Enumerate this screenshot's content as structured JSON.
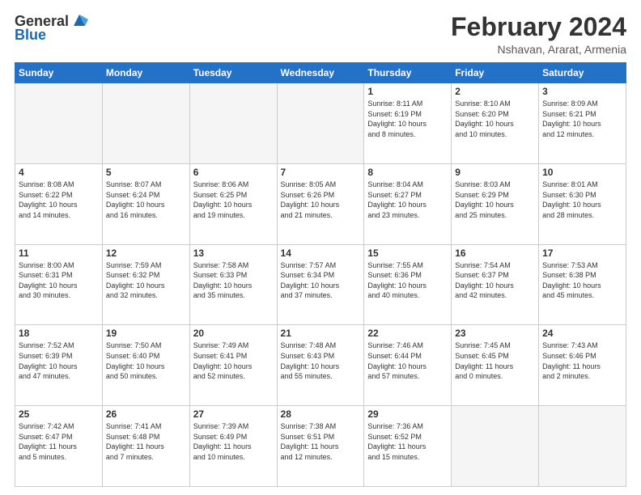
{
  "logo": {
    "general": "General",
    "blue": "Blue"
  },
  "header": {
    "month_year": "February 2024",
    "location": "Nshavan, Ararat, Armenia"
  },
  "weekdays": [
    "Sunday",
    "Monday",
    "Tuesday",
    "Wednesday",
    "Thursday",
    "Friday",
    "Saturday"
  ],
  "weeks": [
    [
      {
        "day": "",
        "info": ""
      },
      {
        "day": "",
        "info": ""
      },
      {
        "day": "",
        "info": ""
      },
      {
        "day": "",
        "info": ""
      },
      {
        "day": "1",
        "info": "Sunrise: 8:11 AM\nSunset: 6:19 PM\nDaylight: 10 hours\nand 8 minutes."
      },
      {
        "day": "2",
        "info": "Sunrise: 8:10 AM\nSunset: 6:20 PM\nDaylight: 10 hours\nand 10 minutes."
      },
      {
        "day": "3",
        "info": "Sunrise: 8:09 AM\nSunset: 6:21 PM\nDaylight: 10 hours\nand 12 minutes."
      }
    ],
    [
      {
        "day": "4",
        "info": "Sunrise: 8:08 AM\nSunset: 6:22 PM\nDaylight: 10 hours\nand 14 minutes."
      },
      {
        "day": "5",
        "info": "Sunrise: 8:07 AM\nSunset: 6:24 PM\nDaylight: 10 hours\nand 16 minutes."
      },
      {
        "day": "6",
        "info": "Sunrise: 8:06 AM\nSunset: 6:25 PM\nDaylight: 10 hours\nand 19 minutes."
      },
      {
        "day": "7",
        "info": "Sunrise: 8:05 AM\nSunset: 6:26 PM\nDaylight: 10 hours\nand 21 minutes."
      },
      {
        "day": "8",
        "info": "Sunrise: 8:04 AM\nSunset: 6:27 PM\nDaylight: 10 hours\nand 23 minutes."
      },
      {
        "day": "9",
        "info": "Sunrise: 8:03 AM\nSunset: 6:29 PM\nDaylight: 10 hours\nand 25 minutes."
      },
      {
        "day": "10",
        "info": "Sunrise: 8:01 AM\nSunset: 6:30 PM\nDaylight: 10 hours\nand 28 minutes."
      }
    ],
    [
      {
        "day": "11",
        "info": "Sunrise: 8:00 AM\nSunset: 6:31 PM\nDaylight: 10 hours\nand 30 minutes."
      },
      {
        "day": "12",
        "info": "Sunrise: 7:59 AM\nSunset: 6:32 PM\nDaylight: 10 hours\nand 32 minutes."
      },
      {
        "day": "13",
        "info": "Sunrise: 7:58 AM\nSunset: 6:33 PM\nDaylight: 10 hours\nand 35 minutes."
      },
      {
        "day": "14",
        "info": "Sunrise: 7:57 AM\nSunset: 6:34 PM\nDaylight: 10 hours\nand 37 minutes."
      },
      {
        "day": "15",
        "info": "Sunrise: 7:55 AM\nSunset: 6:36 PM\nDaylight: 10 hours\nand 40 minutes."
      },
      {
        "day": "16",
        "info": "Sunrise: 7:54 AM\nSunset: 6:37 PM\nDaylight: 10 hours\nand 42 minutes."
      },
      {
        "day": "17",
        "info": "Sunrise: 7:53 AM\nSunset: 6:38 PM\nDaylight: 10 hours\nand 45 minutes."
      }
    ],
    [
      {
        "day": "18",
        "info": "Sunrise: 7:52 AM\nSunset: 6:39 PM\nDaylight: 10 hours\nand 47 minutes."
      },
      {
        "day": "19",
        "info": "Sunrise: 7:50 AM\nSunset: 6:40 PM\nDaylight: 10 hours\nand 50 minutes."
      },
      {
        "day": "20",
        "info": "Sunrise: 7:49 AM\nSunset: 6:41 PM\nDaylight: 10 hours\nand 52 minutes."
      },
      {
        "day": "21",
        "info": "Sunrise: 7:48 AM\nSunset: 6:43 PM\nDaylight: 10 hours\nand 55 minutes."
      },
      {
        "day": "22",
        "info": "Sunrise: 7:46 AM\nSunset: 6:44 PM\nDaylight: 10 hours\nand 57 minutes."
      },
      {
        "day": "23",
        "info": "Sunrise: 7:45 AM\nSunset: 6:45 PM\nDaylight: 11 hours\nand 0 minutes."
      },
      {
        "day": "24",
        "info": "Sunrise: 7:43 AM\nSunset: 6:46 PM\nDaylight: 11 hours\nand 2 minutes."
      }
    ],
    [
      {
        "day": "25",
        "info": "Sunrise: 7:42 AM\nSunset: 6:47 PM\nDaylight: 11 hours\nand 5 minutes."
      },
      {
        "day": "26",
        "info": "Sunrise: 7:41 AM\nSunset: 6:48 PM\nDaylight: 11 hours\nand 7 minutes."
      },
      {
        "day": "27",
        "info": "Sunrise: 7:39 AM\nSunset: 6:49 PM\nDaylight: 11 hours\nand 10 minutes."
      },
      {
        "day": "28",
        "info": "Sunrise: 7:38 AM\nSunset: 6:51 PM\nDaylight: 11 hours\nand 12 minutes."
      },
      {
        "day": "29",
        "info": "Sunrise: 7:36 AM\nSunset: 6:52 PM\nDaylight: 11 hours\nand 15 minutes."
      },
      {
        "day": "",
        "info": ""
      },
      {
        "day": "",
        "info": ""
      }
    ]
  ]
}
